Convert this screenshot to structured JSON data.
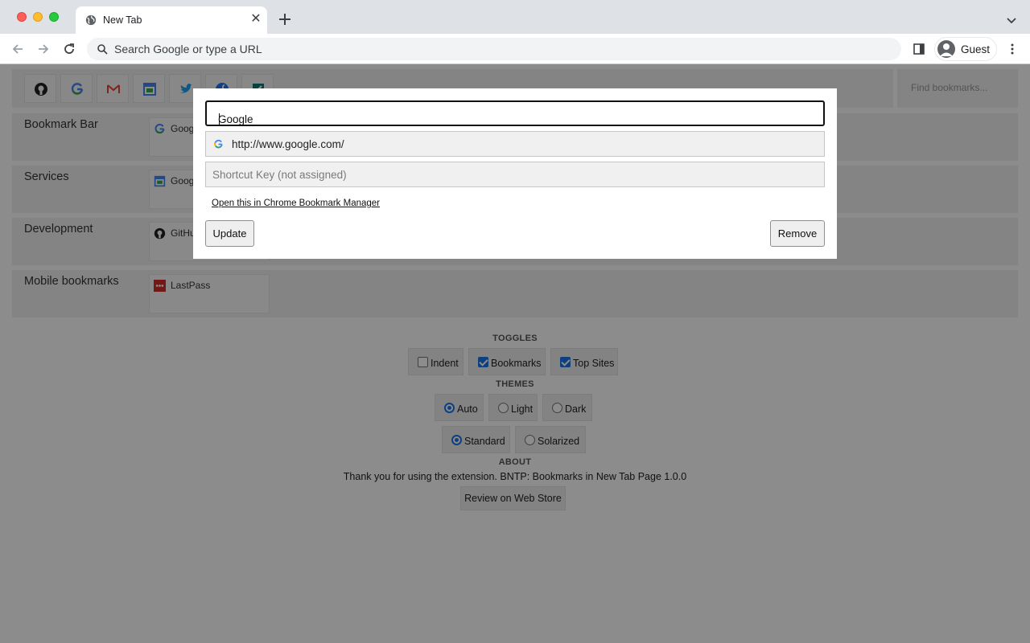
{
  "browser": {
    "tab_title": "New Tab",
    "tab_close": "✕",
    "omnibox_placeholder": "Search Google or type a URL",
    "profile_label": "Guest"
  },
  "top_sites": {
    "icons": [
      "github-icon",
      "google-icon",
      "gmail-icon",
      "google-calendar-icon",
      "twitter-icon",
      "facebook-icon",
      "teal-app-icon"
    ]
  },
  "find_placeholder": "Find bookmarks...",
  "folders": [
    {
      "name": "Bookmark Bar",
      "first_bookmark": "Goog",
      "icon": "google-icon"
    },
    {
      "name": "Services",
      "first_bookmark": "Goog",
      "icon": "google-calendar-icon"
    },
    {
      "name": "Development",
      "first_bookmark": "GitHu",
      "icon": "github-icon"
    },
    {
      "name": "Mobile bookmarks",
      "first_bookmark": "LastPass",
      "icon": "lastpass-icon"
    }
  ],
  "toggles": {
    "heading": "TOGGLES",
    "items": [
      {
        "label": "Indent",
        "checked": false
      },
      {
        "label": "Bookmarks",
        "checked": true
      },
      {
        "label": "Top Sites",
        "checked": true
      }
    ]
  },
  "themes": {
    "heading": "THEMES",
    "mode": [
      {
        "label": "Auto",
        "selected": true
      },
      {
        "label": "Light",
        "selected": false
      },
      {
        "label": "Dark",
        "selected": false
      }
    ],
    "palette": [
      {
        "label": "Standard",
        "selected": true
      },
      {
        "label": "Solarized",
        "selected": false
      }
    ]
  },
  "about": {
    "heading": "ABOUT",
    "text": "Thank you for using the extension. BNTP: Bookmarks in New Tab Page 1.0.0",
    "review_label": "Review on Web Store"
  },
  "edit_dialog": {
    "title_value": "Google",
    "url_value": "http://www.google.com/",
    "shortcut_placeholder": "Shortcut Key (not assigned)",
    "manager_link": "Open this in Chrome Bookmark Manager",
    "update_label": "Update",
    "remove_label": "Remove"
  },
  "colors": {
    "accent": "#1a73e8",
    "overlay": "rgba(0,0,0,0.45)"
  }
}
